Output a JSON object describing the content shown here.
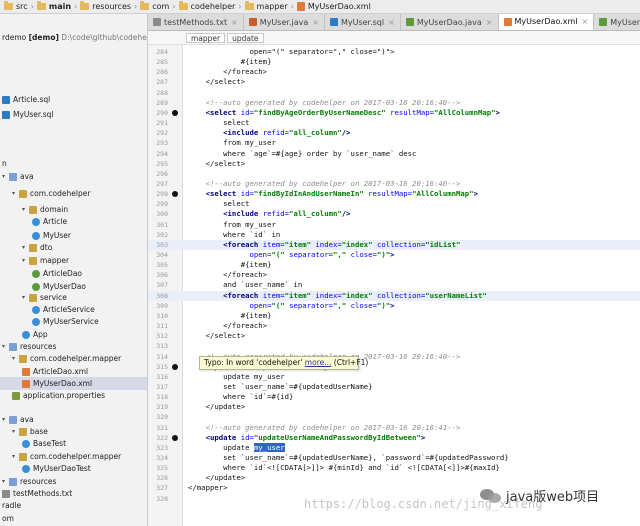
{
  "navbar": {
    "crumbs": [
      "src",
      "main",
      "resources",
      "com",
      "codehelper",
      "mapper",
      "MyUserDao.xml"
    ]
  },
  "tabs": [
    {
      "label": "testMethods.txt",
      "active": false
    },
    {
      "label": "MyUser.java",
      "active": false
    },
    {
      "label": "MyUser.sql",
      "active": false
    },
    {
      "label": "MyUserDao.java",
      "active": false
    },
    {
      "label": "MyUserDao.xml",
      "active": true
    },
    {
      "label": "MyUserService.java",
      "active": false
    }
  ],
  "project": {
    "root_name": "rdemo",
    "root_tag": "[demo]",
    "root_path": "D:\\code\\github\\codehelper",
    "items": [
      {
        "label": "Article.sql",
        "indent": 0,
        "icon": "sql-file-icon"
      },
      {
        "label": "MyUser.sql",
        "indent": 0,
        "icon": "sql-file-icon"
      },
      {
        "label": "n",
        "indent": 0,
        "icon": ""
      },
      {
        "label": "ava",
        "indent": 0,
        "icon": "folder-icon"
      },
      {
        "label": "com.codehelper",
        "indent": 1,
        "icon": "package-icon"
      },
      {
        "label": "domain",
        "indent": 2,
        "icon": "package-icon"
      },
      {
        "label": "Article",
        "indent": 3,
        "icon": "class-icon"
      },
      {
        "label": "MyUser",
        "indent": 3,
        "icon": "class-icon"
      },
      {
        "label": "dto",
        "indent": 2,
        "icon": "package-icon"
      },
      {
        "label": "mapper",
        "indent": 2,
        "icon": "package-icon"
      },
      {
        "label": "ArticleDao",
        "indent": 3,
        "icon": "interface-icon"
      },
      {
        "label": "MyUserDao",
        "indent": 3,
        "icon": "interface-icon"
      },
      {
        "label": "service",
        "indent": 2,
        "icon": "package-icon"
      },
      {
        "label": "ArticleService",
        "indent": 3,
        "icon": "class-icon"
      },
      {
        "label": "MyUserService",
        "indent": 3,
        "icon": "class-icon"
      },
      {
        "label": "App",
        "indent": 2,
        "icon": "class-icon"
      },
      {
        "label": "resources",
        "indent": 0,
        "icon": "folder-icon"
      },
      {
        "label": "com.codehelper.mapper",
        "indent": 1,
        "icon": "package-icon"
      },
      {
        "label": "ArticleDao.xml",
        "indent": 2,
        "icon": "xml-file-icon"
      },
      {
        "label": "MyUserDao.xml",
        "indent": 2,
        "icon": "xml-file-icon"
      },
      {
        "label": "application.properties",
        "indent": 1,
        "icon": "properties-file-icon"
      },
      {
        "label": "",
        "indent": 0,
        "icon": ""
      },
      {
        "label": "ava",
        "indent": 0,
        "icon": "folder-icon"
      },
      {
        "label": "base",
        "indent": 1,
        "icon": "package-icon"
      },
      {
        "label": "BaseTest",
        "indent": 2,
        "icon": "class-icon"
      },
      {
        "label": "com.codehelper.mapper",
        "indent": 1,
        "icon": "package-icon"
      },
      {
        "label": "MyUserDaoTest",
        "indent": 2,
        "icon": "class-icon"
      },
      {
        "label": "resources",
        "indent": 0,
        "icon": "folder-icon"
      },
      {
        "label": "testMethods.txt",
        "indent": 0,
        "icon": "text-file-icon"
      },
      {
        "label": "radle",
        "indent": 0,
        "icon": ""
      },
      {
        "label": "om",
        "indent": 0,
        "icon": ""
      }
    ]
  },
  "editor": {
    "breadcrumb": [
      "mapper",
      "update"
    ],
    "lines": [
      {
        "n": "284",
        "segs": [
          [
            "tx",
            "              open=\"(\" separator=\",\" close=\")\">"
          ]
        ]
      },
      {
        "n": "285",
        "segs": [
          [
            "tx",
            "            #{item}"
          ]
        ]
      },
      {
        "n": "286",
        "segs": [
          [
            "tx",
            "        </foreach>"
          ]
        ]
      },
      {
        "n": "287",
        "segs": [
          [
            "tx",
            "    </select>"
          ]
        ]
      },
      {
        "n": "288",
        "segs": []
      },
      {
        "n": "289",
        "segs": [
          [
            "cm",
            "    <!--auto generated by codehelper on 2017-03-16 20:16:40-->"
          ]
        ]
      },
      {
        "n": "290",
        "segs": [
          [
            "tg",
            "    <select "
          ],
          [
            "at",
            "id="
          ],
          [
            "sv",
            "\"findByAgeOrderByUserNameDesc\""
          ],
          [
            "at",
            " resultMap="
          ],
          [
            "sv",
            "\"AllColumnMap\""
          ],
          [
            "tg",
            ">"
          ]
        ],
        "marker": true
      },
      {
        "n": "291",
        "segs": [
          [
            "tx",
            "        select"
          ]
        ]
      },
      {
        "n": "292",
        "segs": [
          [
            "tg",
            "        <include "
          ],
          [
            "at",
            "refid="
          ],
          [
            "sv",
            "\"all_column\""
          ],
          [
            "tg",
            "/>"
          ]
        ]
      },
      {
        "n": "293",
        "segs": [
          [
            "tx",
            "        from my_user"
          ]
        ]
      },
      {
        "n": "294",
        "segs": [
          [
            "tx",
            "        where `age`=#{age} order by `user_name` desc"
          ]
        ]
      },
      {
        "n": "295",
        "segs": [
          [
            "tx",
            "    </select>"
          ]
        ]
      },
      {
        "n": "296",
        "segs": []
      },
      {
        "n": "297",
        "segs": [
          [
            "cm",
            "    <!--auto generated by codehelper on 2017-03-16 20:16:40-->"
          ]
        ]
      },
      {
        "n": "298",
        "segs": [
          [
            "tg",
            "    <select "
          ],
          [
            "at",
            "id="
          ],
          [
            "sv",
            "\"findByIdInAndUserNameIn\""
          ],
          [
            "at",
            " resultMap="
          ],
          [
            "sv",
            "\"AllColumnMap\""
          ],
          [
            "tg",
            ">"
          ]
        ],
        "marker": true
      },
      {
        "n": "299",
        "segs": [
          [
            "tx",
            "        select"
          ]
        ]
      },
      {
        "n": "300",
        "segs": [
          [
            "tg",
            "        <include "
          ],
          [
            "at",
            "refid="
          ],
          [
            "sv",
            "\"all_column\""
          ],
          [
            "tg",
            "/>"
          ]
        ]
      },
      {
        "n": "301",
        "segs": [
          [
            "tx",
            "        from my_user"
          ]
        ]
      },
      {
        "n": "302",
        "segs": [
          [
            "tx",
            "        where `id` in"
          ]
        ]
      },
      {
        "n": "303",
        "segs": [
          [
            "tg",
            "        <foreach "
          ],
          [
            "at",
            "item="
          ],
          [
            "sv",
            "\"item\""
          ],
          [
            "at",
            " index="
          ],
          [
            "sv",
            "\"index\""
          ],
          [
            "at",
            " collection="
          ],
          [
            "sv",
            "\"idList\""
          ]
        ],
        "hl": true
      },
      {
        "n": "304",
        "segs": [
          [
            "at",
            "              open="
          ],
          [
            "sv",
            "\"(\""
          ],
          [
            "at",
            " separator="
          ],
          [
            "sv",
            "\",\""
          ],
          [
            "at",
            " close="
          ],
          [
            "sv",
            "\")\""
          ],
          [
            "tg",
            ">"
          ]
        ]
      },
      {
        "n": "305",
        "segs": [
          [
            "tx",
            "            #{item}"
          ]
        ]
      },
      {
        "n": "306",
        "segs": [
          [
            "tx",
            "        </foreach>"
          ]
        ]
      },
      {
        "n": "307",
        "segs": [
          [
            "tx",
            "        and `user_name` in"
          ]
        ]
      },
      {
        "n": "308",
        "segs": [
          [
            "tg",
            "        <foreach "
          ],
          [
            "at",
            "item="
          ],
          [
            "sv",
            "\"item\""
          ],
          [
            "at",
            " index="
          ],
          [
            "sv",
            "\"index\""
          ],
          [
            "at",
            " collection="
          ],
          [
            "sv",
            "\"userNameList\""
          ]
        ],
        "hl": true
      },
      {
        "n": "309",
        "segs": [
          [
            "at",
            "              open="
          ],
          [
            "sv",
            "\"(\""
          ],
          [
            "at",
            " separator="
          ],
          [
            "sv",
            "\",\""
          ],
          [
            "at",
            " close="
          ],
          [
            "sv",
            "\")\""
          ],
          [
            "tg",
            ">"
          ]
        ]
      },
      {
        "n": "310",
        "segs": [
          [
            "tx",
            "            #{item}"
          ]
        ]
      },
      {
        "n": "311",
        "segs": [
          [
            "tx",
            "        </foreach>"
          ]
        ]
      },
      {
        "n": "312",
        "segs": [
          [
            "tx",
            "    </select>"
          ]
        ]
      },
      {
        "n": "313",
        "segs": []
      },
      {
        "n": "314",
        "segs": [
          [
            "cm",
            "    <!--auto generated by codehelper on 2017-03-16 20:16:40-->"
          ]
        ]
      },
      {
        "n": "315",
        "segs": [
          [
            "tg",
            "    <update "
          ],
          [
            "at",
            "id="
          ],
          [
            "sv",
            "\"updateUserNameById\""
          ],
          [
            "tg",
            ">"
          ]
        ],
        "marker": true
      },
      {
        "n": "316",
        "segs": [
          [
            "tx",
            "        update my_user"
          ]
        ]
      },
      {
        "n": "317",
        "segs": [
          [
            "tx",
            "        set `user_name`=#{updatedUserName}"
          ]
        ]
      },
      {
        "n": "318",
        "segs": [
          [
            "tx",
            "        where `id`=#{id}"
          ]
        ]
      },
      {
        "n": "319",
        "segs": [
          [
            "tx",
            "    </update>"
          ]
        ]
      },
      {
        "n": "320",
        "segs": []
      },
      {
        "n": "321",
        "segs": [
          [
            "cm",
            "    <!--auto generated by codehelper on 2017-03-16 20:16:41-->"
          ]
        ]
      },
      {
        "n": "322",
        "segs": [
          [
            "tg",
            "    <update "
          ],
          [
            "at",
            "id="
          ],
          [
            "sv",
            "\"updateUserNameAndPasswordByIdBetween\""
          ],
          [
            "tg",
            ">"
          ]
        ],
        "marker": true
      },
      {
        "n": "323",
        "segs": [
          [
            "tx",
            "        update "
          ],
          [
            "sel",
            "my_user"
          ]
        ]
      },
      {
        "n": "324",
        "segs": [
          [
            "tx",
            "        set `user_name`=#{updatedUserName}, `password`=#{updatedPassword}"
          ]
        ]
      },
      {
        "n": "325",
        "segs": [
          [
            "tx",
            "        where `id`<![CDATA[>]]> #{minId} and `id` <![CDATA[<]]>#{maxId}"
          ]
        ]
      },
      {
        "n": "326",
        "segs": [
          [
            "tx",
            "    </update>"
          ]
        ]
      },
      {
        "n": "327",
        "segs": [
          [
            "tx",
            "</mapper>"
          ]
        ]
      },
      {
        "n": "328",
        "segs": []
      }
    ],
    "tooltip": {
      "prefix": "Typo: In word 'codehelper' ",
      "link": "more...",
      "shortcut": " (Ctrl+F1)"
    }
  },
  "watermark": "https://blog.csdn.net/jing_xifeng",
  "wechat_label": "java版web项目"
}
